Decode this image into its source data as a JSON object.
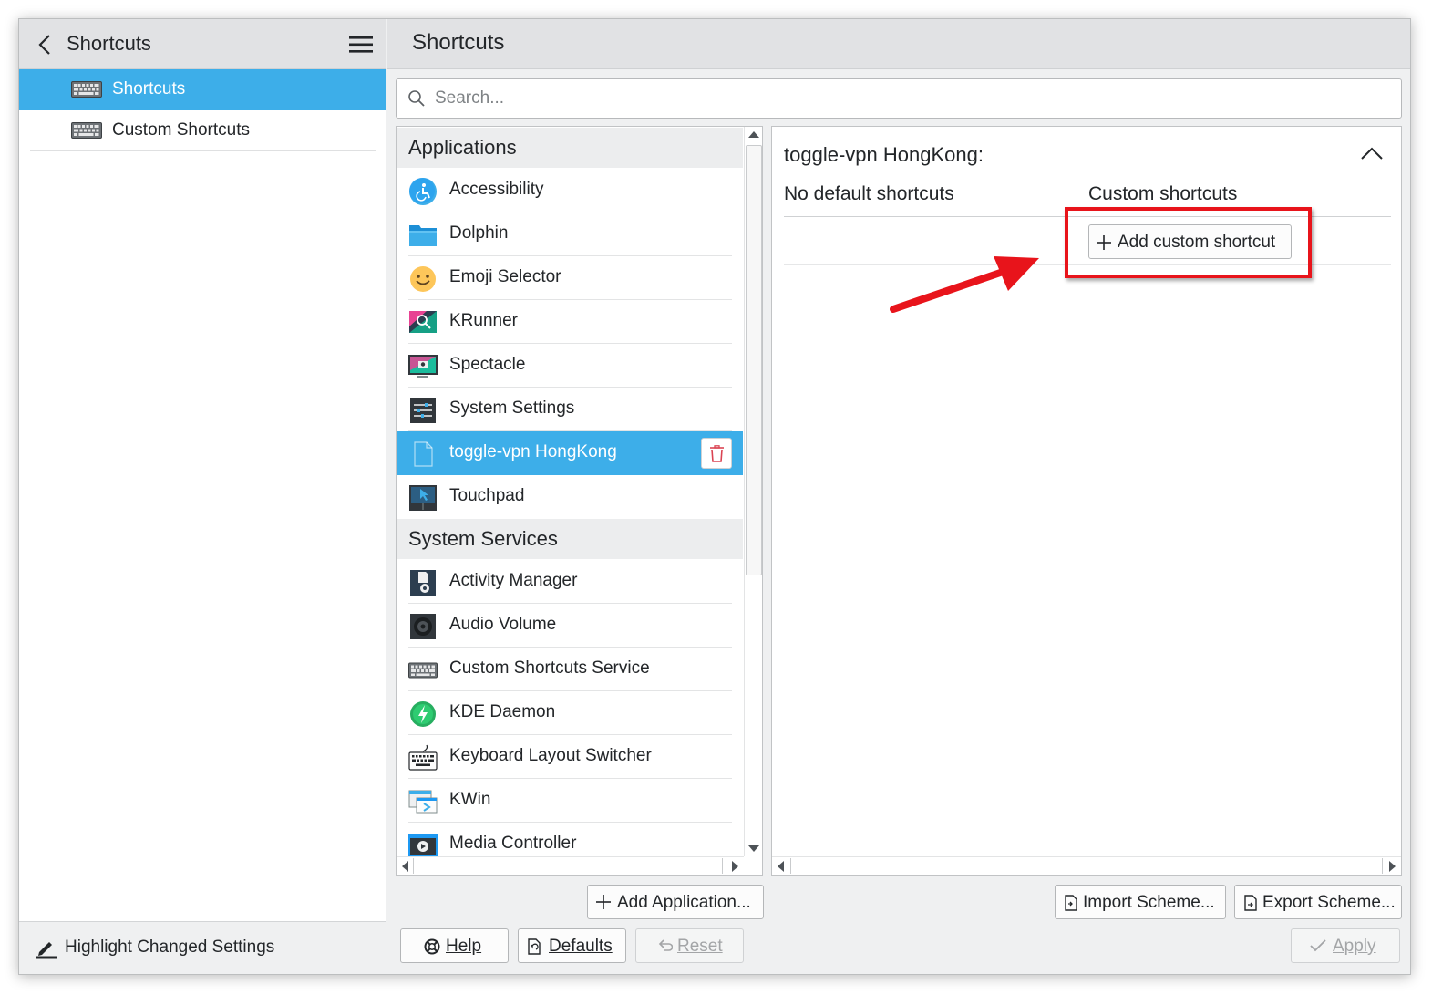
{
  "sidebar": {
    "title": "Shortcuts",
    "items": [
      {
        "label": "Shortcuts",
        "active": true
      },
      {
        "label": "Custom Shortcuts",
        "active": false
      }
    ],
    "footer_label": "Highlight Changed Settings"
  },
  "main": {
    "title": "Shortcuts",
    "search_placeholder": "Search..."
  },
  "list": {
    "groups": [
      {
        "title": "Applications",
        "items": [
          {
            "label": "Accessibility",
            "icon": "accessibility-icon"
          },
          {
            "label": "Dolphin",
            "icon": "folder-icon"
          },
          {
            "label": "Emoji Selector",
            "icon": "emoji-icon"
          },
          {
            "label": "KRunner",
            "icon": "krunner-icon"
          },
          {
            "label": "Spectacle",
            "icon": "spectacle-icon"
          },
          {
            "label": "System Settings",
            "icon": "system-settings-icon"
          },
          {
            "label": "toggle-vpn HongKong",
            "icon": "file-icon",
            "selected": true
          },
          {
            "label": "Touchpad",
            "icon": "touchpad-icon"
          }
        ]
      },
      {
        "title": "System Services",
        "items": [
          {
            "label": "Activity Manager",
            "icon": "activity-manager-icon"
          },
          {
            "label": "Audio Volume",
            "icon": "audio-volume-icon"
          },
          {
            "label": "Custom Shortcuts Service",
            "icon": "keyboard-icon"
          },
          {
            "label": "KDE Daemon",
            "icon": "kde-daemon-icon"
          },
          {
            "label": "Keyboard Layout Switcher",
            "icon": "keyboard-layout-icon"
          },
          {
            "label": "KWin",
            "icon": "kwin-icon"
          },
          {
            "label": "Media Controller",
            "icon": "media-controller-icon"
          }
        ]
      }
    ]
  },
  "detail": {
    "title": "toggle-vpn HongKong:",
    "default_col": "No default shortcuts",
    "custom_col": "Custom shortcuts",
    "add_custom_label": "Add custom shortcut"
  },
  "buttons": {
    "add_application": "Add Application...",
    "import_scheme": "Import Scheme...",
    "export_scheme": "Export Scheme...",
    "help": "Help",
    "defaults": "Defaults",
    "reset": "Reset",
    "apply": "Apply"
  },
  "colors": {
    "accent": "#3daee9",
    "annotation": "#e8141b",
    "trash": "#da4453"
  }
}
